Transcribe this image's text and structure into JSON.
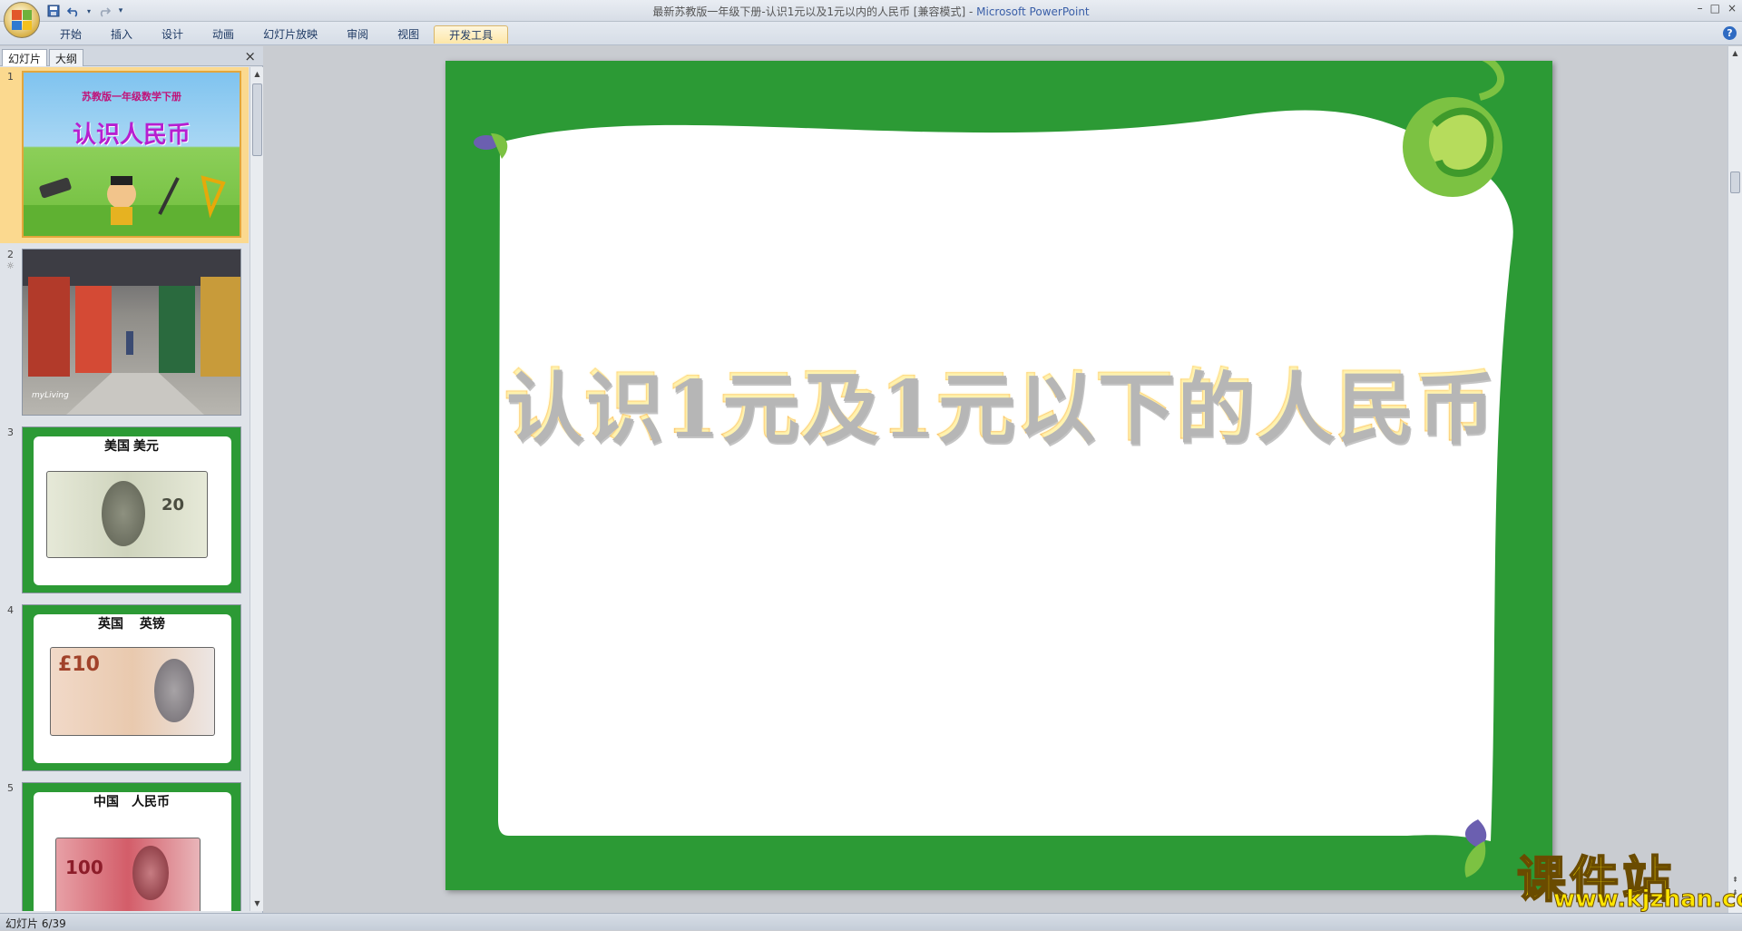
{
  "window": {
    "title": "最新苏教版一年级下册-认识1元以及1元以内的人民币 [兼容模式]",
    "app_name": "Microsoft PowerPoint",
    "separator": " - "
  },
  "quick_access": {
    "icons": [
      "save-icon",
      "undo-icon",
      "redo-icon",
      "customize-icon"
    ]
  },
  "ribbon": {
    "tabs": [
      {
        "label": "开始",
        "active": false
      },
      {
        "label": "插入",
        "active": false
      },
      {
        "label": "设计",
        "active": false
      },
      {
        "label": "动画",
        "active": false
      },
      {
        "label": "幻灯片放映",
        "active": false
      },
      {
        "label": "审阅",
        "active": false
      },
      {
        "label": "视图",
        "active": false
      },
      {
        "label": "开发工具",
        "active": true
      }
    ],
    "help": "?"
  },
  "panel": {
    "tabs": [
      "幻灯片",
      "大纲"
    ],
    "close": "×"
  },
  "thumbnails": [
    {
      "num": "1",
      "line1": "苏教版一年级数学下册",
      "line2": "认识人民币",
      "selected": true
    },
    {
      "num": "2",
      "caption": "myLiving",
      "has_star": true
    },
    {
      "num": "3",
      "label": "美国 美元"
    },
    {
      "num": "4",
      "label": "英国　 英镑"
    },
    {
      "num": "5",
      "label": "中国　人民币"
    }
  ],
  "thumb_star": "☼",
  "slide": {
    "title": "认识1元及1元以下的人民币",
    "background_color": "#2c9a35",
    "title_color": "#f7a12a"
  },
  "status": {
    "text": "幻灯片 6/39"
  },
  "watermark": {
    "cn": "课件站",
    "url": "www.kjzhan.com"
  },
  "window_controls": [
    "–",
    "□",
    "×"
  ]
}
